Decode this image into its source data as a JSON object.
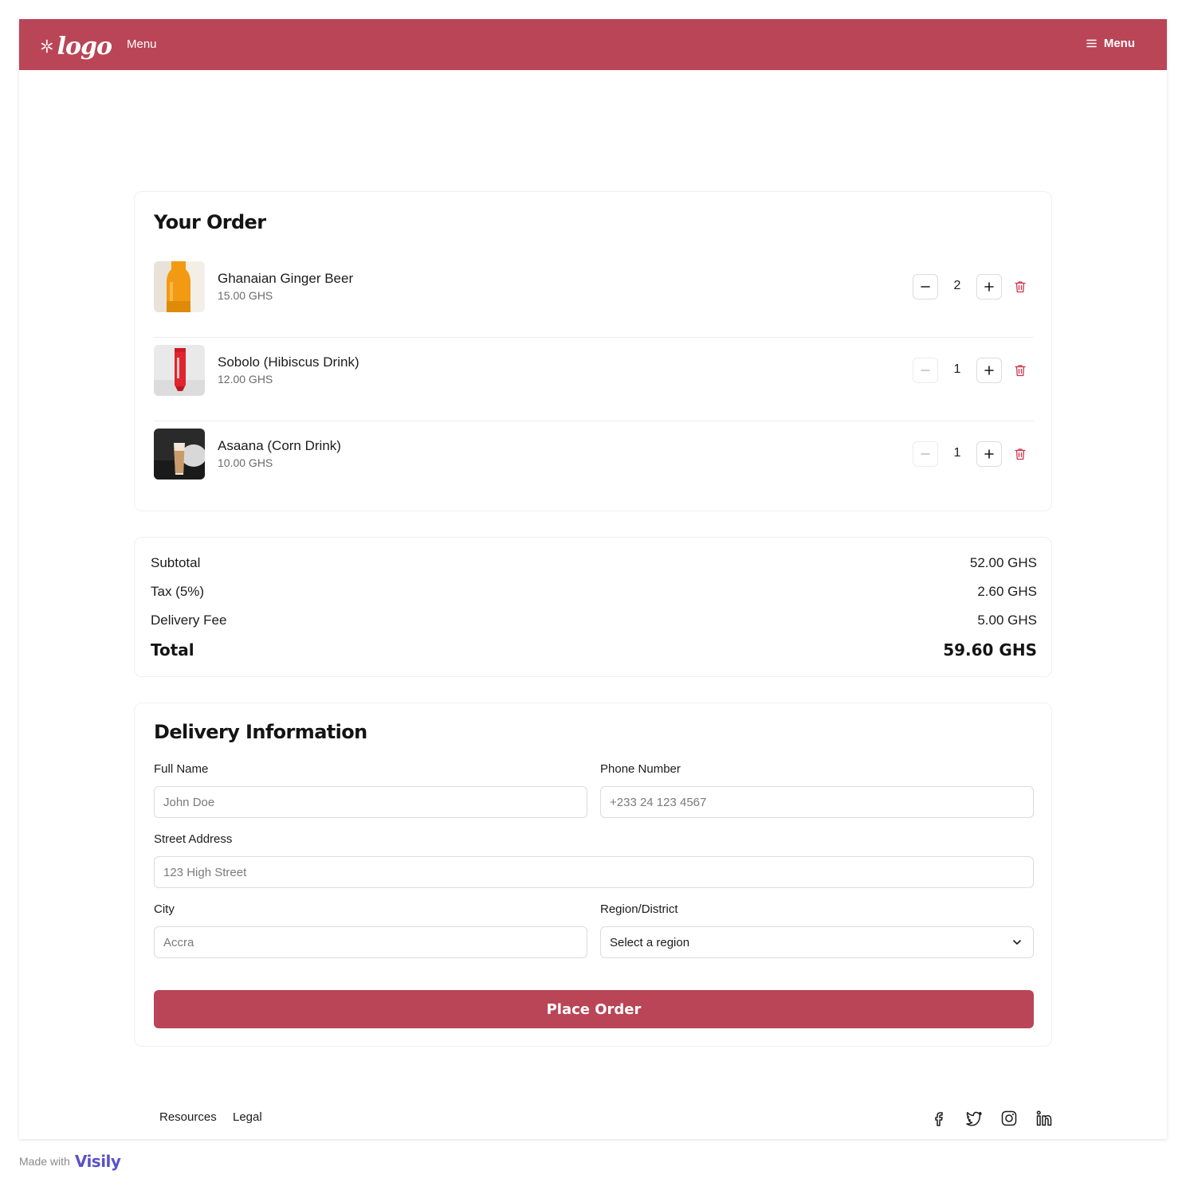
{
  "header": {
    "logo_text": "logo",
    "menu_left": "Menu",
    "menu_right": "Menu",
    "brand_color": "#b94556"
  },
  "order": {
    "title": "Your Order",
    "items": [
      {
        "name": "Ghanaian Ginger Beer",
        "price": "15.00 GHS",
        "quantity": "2",
        "image": "ginger-beer-bottle"
      },
      {
        "name": "Sobolo (Hibiscus Drink)",
        "price": "12.00 GHS",
        "quantity": "1",
        "image": "red-tube-drink"
      },
      {
        "name": "Asaana (Corn Drink)",
        "price": "10.00 GHS",
        "quantity": "1",
        "image": "corn-drink-glass"
      }
    ]
  },
  "summary": {
    "subtotal_label": "Subtotal",
    "subtotal_value": "52.00 GHS",
    "tax_label": "Tax (5%)",
    "tax_value": "2.60 GHS",
    "delivery_label": "Delivery Fee",
    "delivery_value": "5.00 GHS",
    "total_label": "Total",
    "total_value": "59.60 GHS"
  },
  "delivery": {
    "title": "Delivery Information",
    "full_name_label": "Full Name",
    "full_name_placeholder": "John Doe",
    "phone_label": "Phone Number",
    "phone_placeholder": "+233 24 123 4567",
    "street_label": "Street Address",
    "street_placeholder": "123 High Street",
    "city_label": "City",
    "city_placeholder": "Accra",
    "region_label": "Region/District",
    "region_value": "Select a region",
    "place_order": "Place Order"
  },
  "footer": {
    "links": [
      "Resources",
      "Legal"
    ],
    "social": [
      "facebook-icon",
      "twitter-icon",
      "instagram-icon",
      "linkedin-icon"
    ]
  },
  "badge": {
    "made_with": "Made with",
    "brand": "Visily"
  }
}
